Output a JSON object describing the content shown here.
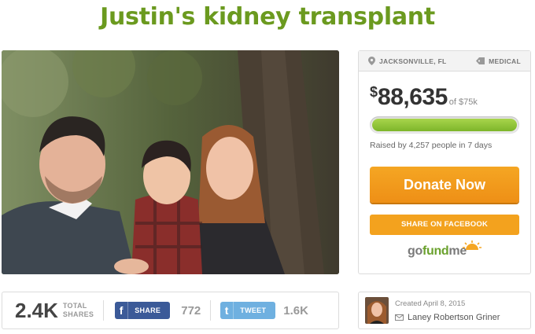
{
  "campaign": {
    "title": "Justin's kidney transplant"
  },
  "sidebar": {
    "location": "JACKSONVILLE, FL",
    "category": "MEDICAL",
    "amount_symbol": "$",
    "amount_raised": "88,635",
    "goal_text": "of $75k",
    "progress_fraction": 1.0,
    "raised_text": "Raised by 4,257 people in 7 days",
    "donate_label": "Donate Now",
    "share_facebook_label": "SHARE ON FACEBOOK",
    "logo": {
      "go": "go",
      "fund": "fund",
      "me": "me"
    }
  },
  "shares": {
    "total": "2.4K",
    "total_label_1": "TOTAL",
    "total_label_2": "SHARES",
    "facebook_label": "SHARE",
    "facebook_count": "772",
    "twitter_label": "TWEET",
    "twitter_count": "1.6K"
  },
  "creator": {
    "created": "Created April 8, 2015",
    "name": "Laney Robertson Griner"
  },
  "colors": {
    "title_green": "#6b9a1f",
    "donate_orange": "#f5a623",
    "progress_green": "#8cc63f",
    "facebook_blue": "#3b5a98",
    "twitter_blue": "#6fb0e0"
  },
  "icons": {
    "location": "map-pin-icon",
    "category": "tag-icon",
    "facebook": "facebook-icon",
    "twitter": "twitter-icon",
    "mail": "mail-icon"
  }
}
